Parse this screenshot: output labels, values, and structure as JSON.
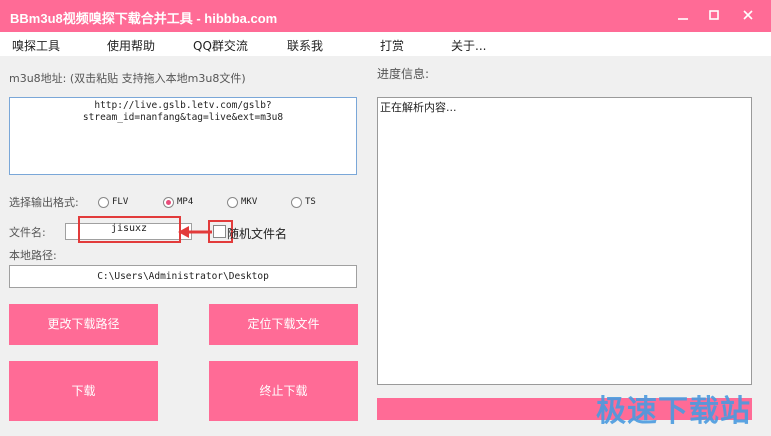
{
  "window": {
    "title": "BBm3u8视频嗅探下载合并工具 - hibbba.com"
  },
  "menu": [
    "嗅探工具",
    "使用帮助",
    "QQ群交流",
    "联系我",
    "打赏",
    "关于..."
  ],
  "left": {
    "url_label": "m3u8地址: (双击粘贴 支持拖入本地m3u8文件)",
    "url_value": "http://live.gslb.letv.com/gslb?\nstream_id=nanfang&tag=live&ext=m3u8",
    "format_label": "选择输出格式:",
    "formats": [
      {
        "label": "FLV",
        "selected": false
      },
      {
        "label": "MP4",
        "selected": true
      },
      {
        "label": "MKV",
        "selected": false
      },
      {
        "label": "TS",
        "selected": false
      }
    ],
    "filename_label": "文件名:",
    "filename_value": "jisuxz",
    "random_label": "随机文件名",
    "path_label": "本地路径:",
    "path_value": "C:\\Users\\Administrator\\Desktop",
    "buttons": {
      "change_path": "更改下载路径",
      "locate_file": "定位下载文件",
      "download": "下载",
      "stop_download": "终止下载"
    }
  },
  "right": {
    "progress_label": "进度信息:",
    "progress_text": "正在解析内容..."
  },
  "watermark": "极速下载站",
  "colors": {
    "accent": "#ff6b96",
    "highlight": "#e23b3b",
    "watermark": "#4a9be0"
  }
}
